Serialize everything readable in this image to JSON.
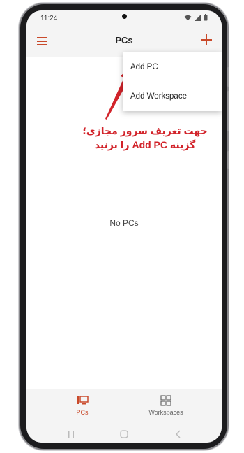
{
  "status_bar": {
    "time": "11:24"
  },
  "app_bar": {
    "title": "PCs",
    "menu_icon": "hamburger-menu-icon",
    "add_icon": "plus-icon"
  },
  "dropdown": {
    "items": [
      {
        "label": "Add PC"
      },
      {
        "label": "Add Workspace"
      }
    ]
  },
  "annotation": {
    "line1": "جهت تعریف سرور مجازی؛",
    "line2": "گزینه Add PC را بزنید"
  },
  "content": {
    "empty_message": "No PCs"
  },
  "bottom_nav": {
    "items": [
      {
        "label": "PCs",
        "icon": "monitor-icon",
        "active": true
      },
      {
        "label": "Workspaces",
        "icon": "grid-icon",
        "active": false
      }
    ]
  },
  "colors": {
    "accent": "#c94a2b",
    "annotation": "#d2232a",
    "bar_bg": "#f4f4f4"
  }
}
